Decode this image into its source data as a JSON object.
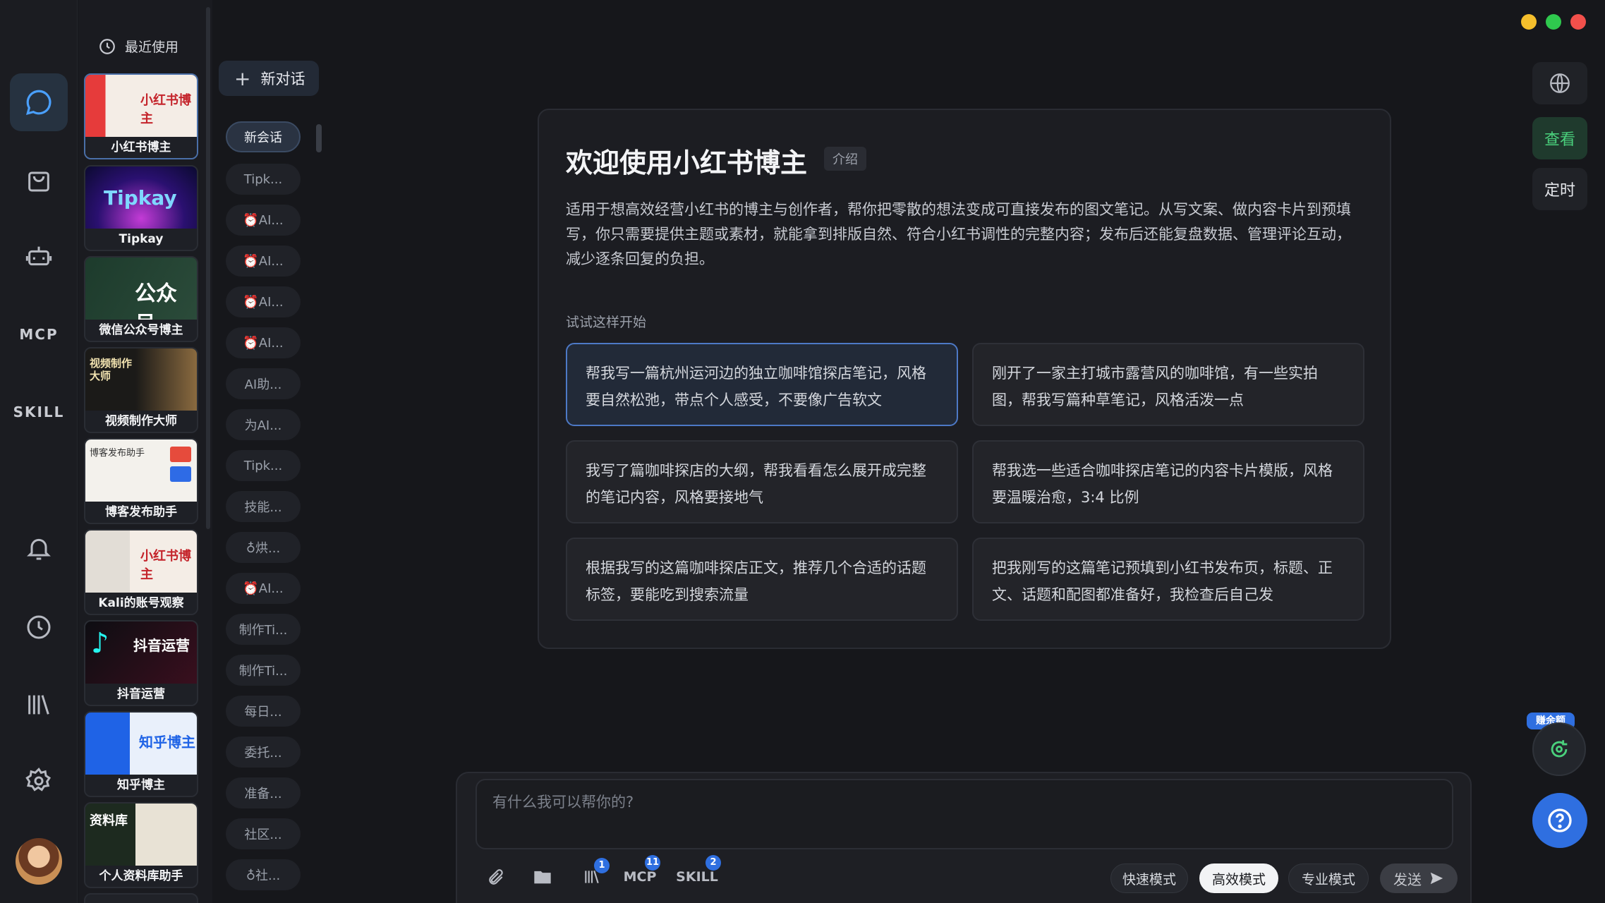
{
  "window": {
    "dots": [
      "#f5bf2c",
      "#2fc94e",
      "#f2504b"
    ]
  },
  "rail": {
    "mcp_label": "MCP",
    "skill_label": "SKILL"
  },
  "apps": {
    "recent_label": "最近使用",
    "items": [
      {
        "label": "小红书博主",
        "thumb_text": "小红书博主"
      },
      {
        "label": "Tipkay",
        "thumb_text": "Tipkay"
      },
      {
        "label": "微信公众号博主",
        "thumb_text": "公众号"
      },
      {
        "label": "视频制作大师",
        "thumb_text": "视频制作大师"
      },
      {
        "label": "博客发布助手",
        "thumb_text": "博客发布助手"
      },
      {
        "label": "Kali的账号观察",
        "thumb_text": "小红书博主"
      },
      {
        "label": "抖音运营",
        "thumb_text": "抖音运营"
      },
      {
        "label": "知乎博主",
        "thumb_text": "知乎博主"
      },
      {
        "label": "个人资料库助手",
        "thumb_text": "资料库"
      }
    ]
  },
  "sessions": {
    "new_chat_label": "新对话",
    "items": [
      "新会话",
      "Tipk...",
      "⏰AI...",
      "⏰AI...",
      "⏰AI...",
      "⏰AI...",
      "AI助...",
      "为AI...",
      "Tipk...",
      "技能...",
      "♁烘...",
      "⏰AI...",
      "制作Ti...",
      "制作Ti...",
      "每日...",
      "委托...",
      "准备...",
      "社区...",
      "♁社..."
    ]
  },
  "welcome": {
    "title": "欢迎使用小红书博主",
    "tag": "介绍",
    "description": "适用于想高效经营小红书的博主与创作者，帮你把零散的想法变成可直接发布的图文笔记。从写文案、做内容卡片到预填写，你只需要提供主题或素材，就能拿到排版自然、符合小红书调性的完整内容；发布后还能复盘数据、管理评论互动，减少逐条回复的负担。",
    "try_label": "试试这样开始",
    "suggestions": [
      "帮我写一篇杭州运河边的独立咖啡馆探店笔记，风格要自然松弛，带点个人感受，不要像广告软文",
      "刚开了一家主打城市露营风的咖啡馆，有一些实拍图，帮我写篇种草笔记，风格活泼一点",
      "我写了篇咖啡探店的大纲，帮我看看怎么展开成完整的笔记内容，风格要接地气",
      "帮我选一些适合咖啡探店笔记的内容卡片模版，风格要温暖治愈，3:4 比例",
      "根据我写的这篇咖啡探店正文，推荐几个合适的话题标签，要能吃到搜索流量",
      "把我刚写的这篇笔记预填到小红书发布页，标题、正文、话题和配图都准备好，我检查后自己发"
    ]
  },
  "composer": {
    "placeholder": "有什么我可以帮你的?",
    "library_badge": "1",
    "mcp_label": "MCP",
    "mcp_badge": "11",
    "skill_label": "SKILL",
    "skill_badge": "2",
    "modes": [
      "快速模式",
      "高效模式",
      "专业模式"
    ],
    "active_mode": "高效模式",
    "send_label": "发送"
  },
  "right": {
    "view_label": "查看",
    "schedule_label": "定时",
    "earn_label": "赚余额"
  }
}
